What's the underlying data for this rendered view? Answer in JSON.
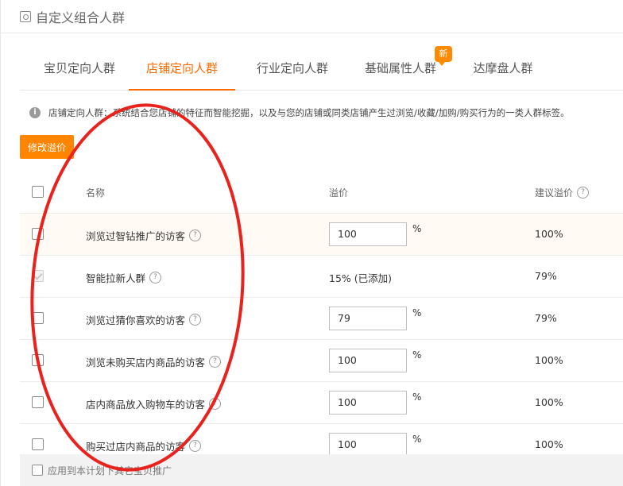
{
  "header": {
    "title": "自定义组合人群",
    "icon": "audience-icon"
  },
  "tabs": [
    {
      "label": "宝贝定向人群",
      "active": false
    },
    {
      "label": "店铺定向人群",
      "active": true
    },
    {
      "label": "行业定向人群",
      "active": false
    },
    {
      "label": "基础属性人群",
      "active": false
    },
    {
      "label": "达摩盘人群",
      "active": false
    }
  ],
  "new_badge": "新",
  "info": {
    "icon": "info-icon",
    "text": "店铺定向人群：系统结合您店铺的特征而智能挖掘，以及与您的店铺或同类店铺产生过浏览/收藏/加购/购买行为的一类人群标签。"
  },
  "buttons": {
    "modify_price": "修改溢价"
  },
  "table": {
    "headers": {
      "name": "名称",
      "price": "溢价",
      "suggest": "建议溢价"
    },
    "rows": [
      {
        "name": "浏览过智钻推广的访客",
        "price": "100",
        "suggest": "100%"
      },
      {
        "name": "智能拉新人群",
        "price_static": "15% (已添加)",
        "suggest": "79%"
      },
      {
        "name": "浏览过猜你喜欢的访客",
        "price": "79",
        "suggest": "79%"
      },
      {
        "name": "浏览未购买店内商品的访客",
        "price": "100",
        "suggest": "100%"
      },
      {
        "name": "店内商品放入购物车的访客",
        "price": "100",
        "suggest": "100%"
      },
      {
        "name": "购买过店内商品的访客",
        "price": "100",
        "suggest": "100%"
      }
    ],
    "percent_sign": "%",
    "help_glyph": "?"
  },
  "footer": {
    "apply_label": "应用到本计划下其它宝贝推广"
  },
  "colors": {
    "accent": "#ff6a00",
    "button": "#ff8400",
    "annotation": "#e8231d"
  }
}
